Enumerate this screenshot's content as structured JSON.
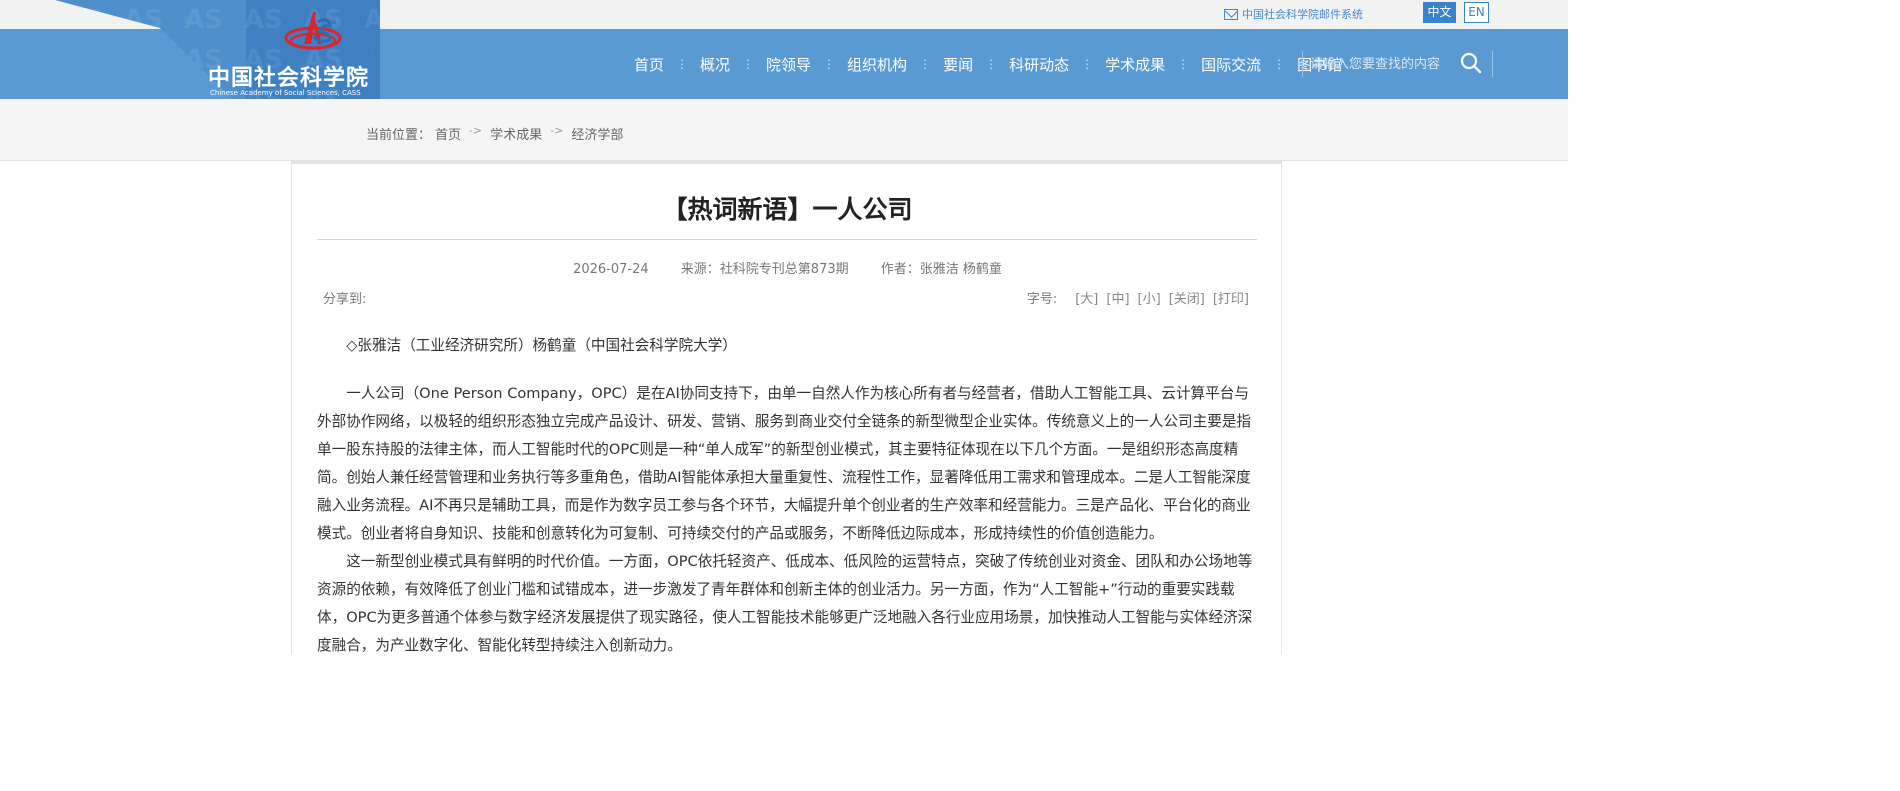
{
  "topbar": {
    "mail_label": "中国社会科学院邮件系统",
    "lang_zh": "中文",
    "lang_en": "EN"
  },
  "logo": {
    "name": "中国社会科学院",
    "english": "Chinese Academy of Social Sciences, CASS"
  },
  "nav": {
    "items": [
      "首页",
      "概况",
      "院领导",
      "组织机构",
      "要闻",
      "科研动态",
      "学术成果",
      "国际交流",
      "图书馆"
    ],
    "separator": "⋮",
    "search_placeholder": "请输入您要查找的内容"
  },
  "breadcrumb": {
    "label": "当前位置：",
    "items": [
      "首页",
      "学术成果",
      "经济学部"
    ],
    "arrow": "->"
  },
  "article": {
    "title": "【热词新语】一人公司",
    "date": "2026-07-24",
    "source": "来源：社科院专刊总第873期",
    "author": "作者：张雅洁 杨鹤童",
    "share_label": "分享到:",
    "font_label": "字号:",
    "font_options": [
      "[大]",
      "[中]",
      "[小]",
      "[关闭]",
      "[打印]"
    ],
    "byline": "◇张雅洁（工业经济研究所）杨鹤童（中国社会科学院大学）",
    "paragraphs": [
      "一人公司（One Person Company，OPC）是在AI协同支持下，由单一自然人作为核心所有者与经营者，借助人工智能工具、云计算平台与外部协作网络，以极轻的组织形态独立完成产品设计、研发、营销、服务到商业交付全链条的新型微型企业实体。传统意义上的一人公司主要是指单一股东持股的法律主体，而人工智能时代的OPC则是一种“单人成军”的新型创业模式，其主要特征体现在以下几个方面。一是组织形态高度精简。创始人兼任经营管理和业务执行等多重角色，借助AI智能体承担大量重复性、流程性工作，显著降低用工需求和管理成本。二是人工智能深度融入业务流程。AI不再只是辅助工具，而是作为数字员工参与各个环节，大幅提升单个创业者的生产效率和经营能力。三是产品化、平台化的商业模式。创业者将自身知识、技能和创意转化为可复制、可持续交付的产品或服务，不断降低边际成本，形成持续性的价值创造能力。",
      "这一新型创业模式具有鲜明的时代价值。一方面，OPC依托轻资产、低成本、低风险的运营特点，突破了传统创业对资金、团队和办公场地等资源的依赖，有效降低了创业门槛和试错成本，进一步激发了青年群体和创新主体的创业活力。另一方面，作为“人工智能+”行动的重要实践载体，OPC为更多普通个体参与数字经济发展提供了现实路径，使人工智能技术能够更广泛地融入各行业应用场景，加快推动人工智能与实体经济深度融合，为产业数字化、智能化转型持续注入创新动力。"
    ]
  },
  "colors": {
    "nav_bg": "#5a9ad3",
    "accent": "#3a82c9",
    "crumb_bg": "#f5f5f5"
  },
  "icons": [
    "mail-icon",
    "search-icon",
    "cass-emblem"
  ]
}
